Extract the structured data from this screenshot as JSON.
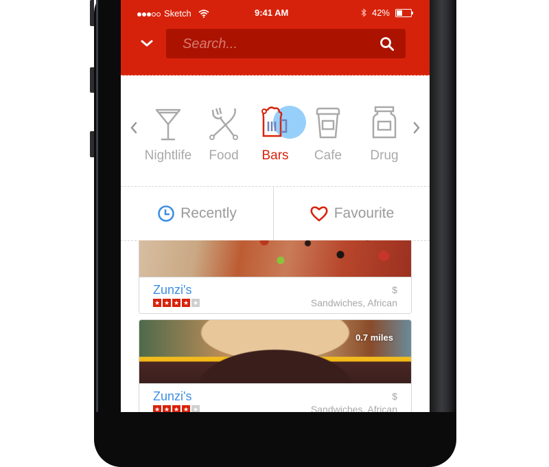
{
  "status_bar": {
    "carrier": "Sketch",
    "signal_bars_full": 3,
    "signal_bars_total": 5,
    "time": "9:41 AM",
    "battery_percent": "42%",
    "battery_level": 0.42
  },
  "header": {
    "menu_icon": "chevron-down-icon",
    "search": {
      "placeholder": "Search...",
      "value": ""
    },
    "search_icon": "search-icon"
  },
  "categories": {
    "items": [
      {
        "label": "Nightlife",
        "icon": "cocktail-glass-icon",
        "active": false
      },
      {
        "label": "Food",
        "icon": "fork-knife-icon",
        "active": false
      },
      {
        "label": "Bars",
        "icon": "beer-mug-icon",
        "active": true
      },
      {
        "label": "Cafe",
        "icon": "coffee-cup-icon",
        "active": false
      },
      {
        "label": "Drug",
        "icon": "pill-bottle-icon",
        "active": false
      }
    ]
  },
  "tabs": [
    {
      "label": "Recently",
      "icon": "clock-icon"
    },
    {
      "label": "Favourite",
      "icon": "heart-icon"
    }
  ],
  "listings": [
    {
      "name": "Zunzi's",
      "rating": 4,
      "rating_max": 5,
      "price": "$",
      "tags": "Sandwiches, African",
      "image": "pizza",
      "distance": ""
    },
    {
      "name": "Zunzi's",
      "rating": 4,
      "rating_max": 5,
      "price": "$",
      "tags": "Sandwiches, African",
      "image": "burger",
      "distance": "0.7 miles"
    }
  ],
  "colors": {
    "brand_red": "#d7220b",
    "search_bg": "#ac1200",
    "link_blue": "#3d8fe0",
    "muted_gray": "#a9a9a9",
    "ripple_blue": "#40aaf5"
  }
}
